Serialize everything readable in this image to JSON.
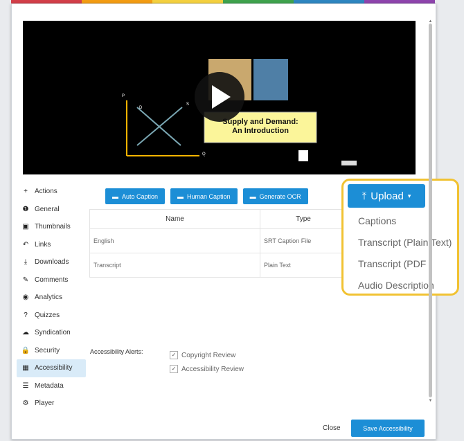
{
  "colors": {
    "accent": "#1c8ed6",
    "highlight": "#f1c232"
  },
  "rainbow": [
    "#d33f49",
    "#f39c12",
    "#f4d03f",
    "#3fa34d",
    "#2e86c1",
    "#8e44ad"
  ],
  "video": {
    "title_line1": "Supply and Demand:",
    "title_line2": "An Introduction",
    "axis_p": "P",
    "axis_q": "Q",
    "label_d": "D",
    "label_s": "S"
  },
  "sidebar": {
    "items": [
      {
        "label": "Actions",
        "icon": "+"
      },
      {
        "label": "General",
        "icon": "❶"
      },
      {
        "label": "Thumbnails",
        "icon": "▣"
      },
      {
        "label": "Links",
        "icon": "↶"
      },
      {
        "label": "Downloads",
        "icon": "⤓"
      },
      {
        "label": "Comments",
        "icon": "✎"
      },
      {
        "label": "Analytics",
        "icon": "◉"
      },
      {
        "label": "Quizzes",
        "icon": "?"
      },
      {
        "label": "Syndication",
        "icon": "☁"
      },
      {
        "label": "Security",
        "icon": "🔒"
      },
      {
        "label": "Accessibility",
        "icon": "▦"
      },
      {
        "label": "Metadata",
        "icon": "☰"
      },
      {
        "label": "Player",
        "icon": "⚙"
      }
    ]
  },
  "toolbar": {
    "auto_caption": "Auto Caption",
    "human_caption": "Human Caption",
    "generate_ocr": "Generate OCR",
    "upload": "Upload"
  },
  "upload_menu": {
    "items": [
      "Captions",
      "Transcript (Plain Text)",
      "Transcript (PDF",
      "Audio Description"
    ]
  },
  "table": {
    "headers": [
      "Name",
      "Type"
    ],
    "rows": [
      {
        "name": "English",
        "type": "SRT Caption File"
      },
      {
        "name": "Transcript",
        "type": "Plain Text"
      }
    ]
  },
  "alerts": {
    "label": "Accessibility Alerts:",
    "options": [
      "Copyright Review",
      "Accessibility Review"
    ]
  },
  "footer": {
    "close": "Close",
    "save": "Save Accessibility"
  }
}
